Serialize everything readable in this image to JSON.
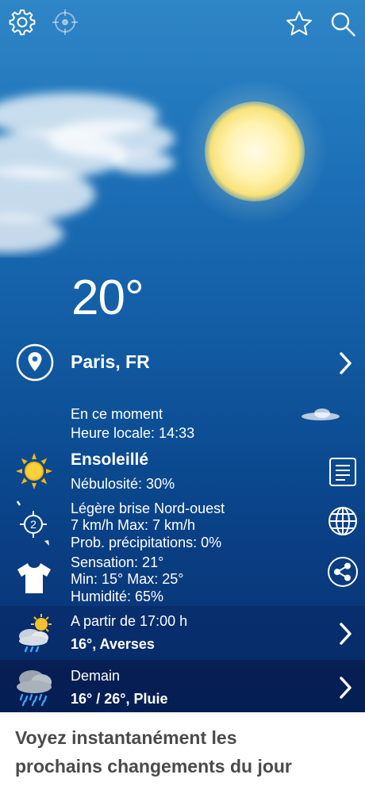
{
  "topbar": {
    "settings_icon": "gear-icon",
    "locate_icon": "crosshair-icon",
    "favorite_icon": "star-icon",
    "search_icon": "search-icon"
  },
  "current": {
    "temperature": "20°",
    "location": "Paris, FR",
    "moment_label": "En ce moment",
    "local_time": "Heure locale: 14:33",
    "condition": "Ensoleillé",
    "cloudiness": "Nébulosité: 30%",
    "wind_desc": "Légère brise Nord-ouest",
    "wind_speed": "7 km/h Max: 7 km/h",
    "wind_force": "2",
    "precip": "Prob. précipitations: 0%",
    "feels_like": "Sensation: 21°",
    "min_max": "Min: 15°  Max: 25°",
    "humidity": "Humidité: 65%"
  },
  "forecast": [
    {
      "label": "A partir de 17:00 h",
      "value": "16°, Averses"
    },
    {
      "label": "Demain",
      "value": "16° / 26°, Pluie"
    }
  ],
  "caption": {
    "line1": "Voyez instantanément les",
    "line2": "prochains changements du jour"
  },
  "colors": {
    "sky_top": "#2f86c7",
    "sky_bottom": "#07306e",
    "caption_text": "#4a4a4a"
  }
}
